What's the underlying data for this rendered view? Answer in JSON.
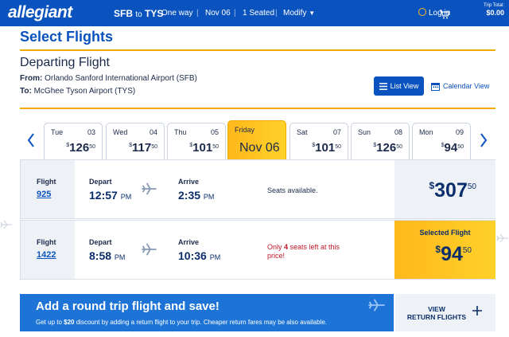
{
  "header": {
    "logo": "allegiant",
    "route_from": "SFB",
    "route_to_word": "to",
    "route_to": "TYS",
    "trip_type": "One way",
    "date": "Nov 06",
    "seated": "1 Seated",
    "modify": "Modify",
    "login": "Log in",
    "trip_total_label": "Trip Total:",
    "trip_total": "$0.00"
  },
  "page_title": "Select Flights",
  "departing": {
    "title": "Departing Flight",
    "from_label": "From:",
    "from_value": "Orlando Sanford International Airport (SFB)",
    "to_label": "To:",
    "to_value": "McGhee Tyson Airport (TYS)"
  },
  "view_toggle": {
    "list_view": "List View",
    "calendar_view": "Calendar View"
  },
  "dates": [
    {
      "dow": "Tue",
      "day": "03",
      "dollars": "126",
      "cents": "50"
    },
    {
      "dow": "Wed",
      "day": "04",
      "dollars": "117",
      "cents": "50"
    },
    {
      "dow": "Thu",
      "day": "05",
      "dollars": "101",
      "cents": "50"
    },
    {
      "dow": "Friday",
      "date": "Nov 06"
    },
    {
      "dow": "Sat",
      "day": "07",
      "dollars": "101",
      "cents": "50"
    },
    {
      "dow": "Sun",
      "day": "08",
      "dollars": "126",
      "cents": "50"
    },
    {
      "dow": "Mon",
      "day": "09",
      "dollars": "94",
      "cents": "50"
    }
  ],
  "flights": [
    {
      "flight_label": "Flight",
      "flight_number": "925",
      "depart_label": "Depart",
      "depart_time": "12:57",
      "depart_ampm": "PM",
      "arrive_label": "Arrive",
      "arrive_time": "2:35",
      "arrive_ampm": "PM",
      "seats_text": "Seats available.",
      "dollar_sign": "$",
      "price_dollars": "307",
      "price_cents": "50"
    },
    {
      "flight_label": "Flight",
      "flight_number": "1422",
      "depart_label": "Depart",
      "depart_time": "8:58",
      "depart_ampm": "PM",
      "arrive_label": "Arrive",
      "arrive_time": "10:36",
      "arrive_ampm": "PM",
      "seats_prefix": "Only ",
      "seats_count": "4",
      "seats_suffix": " seats left at this price!",
      "selected_label": "Selected Flight",
      "dollar_sign": "$",
      "price_dollars": "94",
      "price_cents": "50"
    }
  ],
  "promo": {
    "headline": "Add a round trip flight and save!",
    "text_prefix": "Get up to ",
    "text_amount": "$20",
    "text_suffix": " discount by adding a return flight to your trip. Cheaper return fares may be also available.",
    "cta_line1": "VIEW",
    "cta_line2": "RETURN FLIGHTS"
  },
  "colors": {
    "brand_blue": "#0a53be",
    "accent_yellow": "#ffb81c",
    "warning_red": "#c0182a"
  }
}
